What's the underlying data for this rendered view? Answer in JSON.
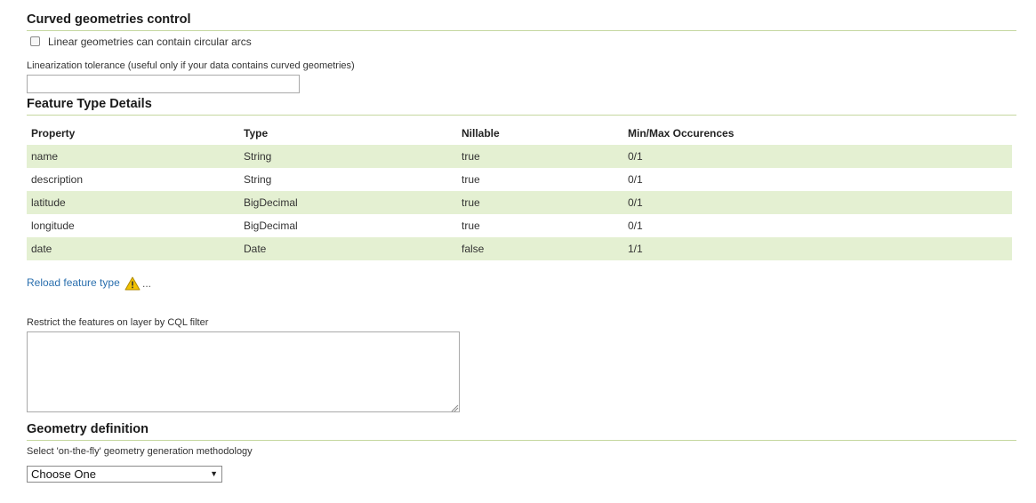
{
  "curved": {
    "title": "Curved geometries control",
    "checkbox_label": "Linear geometries can contain circular arcs",
    "tolerance_label": "Linearization tolerance (useful only if your data contains curved geometries)",
    "tolerance_value": ""
  },
  "feature": {
    "title": "Feature Type Details",
    "headers": [
      "Property",
      "Type",
      "Nillable",
      "Min/Max Occurences"
    ],
    "rows": [
      [
        "name",
        "String",
        "true",
        "0/1"
      ],
      [
        "description",
        "String",
        "true",
        "0/1"
      ],
      [
        "latitude",
        "BigDecimal",
        "true",
        "0/1"
      ],
      [
        "longitude",
        "BigDecimal",
        "true",
        "0/1"
      ],
      [
        "date",
        "Date",
        "false",
        "1/1"
      ]
    ],
    "reload_label": "Reload feature type",
    "ellipsis": "..."
  },
  "cql": {
    "label": "Restrict the features on layer by CQL filter",
    "value": ""
  },
  "geometry": {
    "title": "Geometry definition",
    "select_label": "Select 'on-the-fly' geometry generation methodology",
    "select_value": "Choose One"
  },
  "colors": {
    "row_stripe": "#e4f0d2",
    "rule": "#c5d7a0",
    "link": "#2a6fae",
    "warning": "#f2c200"
  }
}
